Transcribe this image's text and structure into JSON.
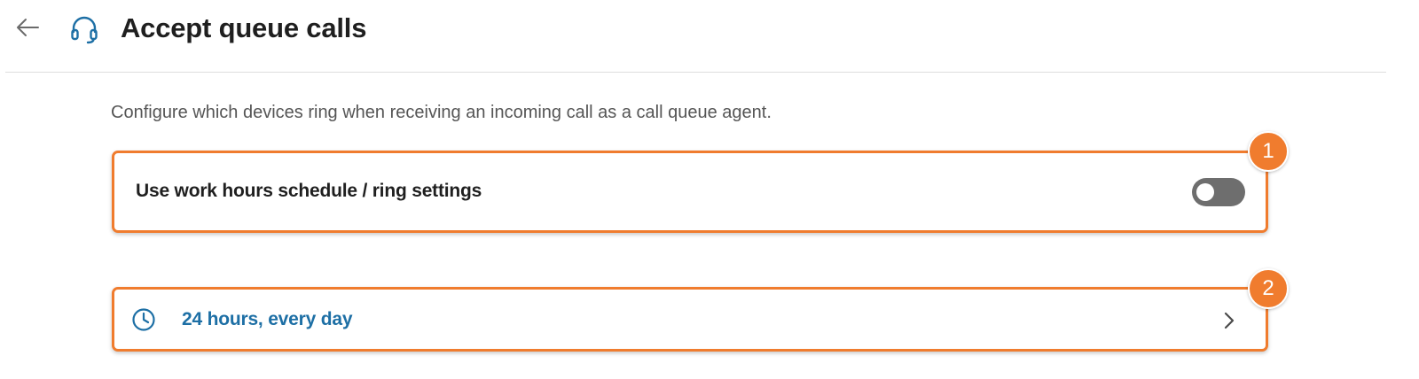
{
  "header": {
    "title": "Accept queue calls",
    "back_icon": "arrow-left-icon",
    "title_icon": "headset-icon"
  },
  "description": "Configure which devices ring when receiving an incoming call as a call queue agent.",
  "work_hours_setting": {
    "label": "Use work hours schedule / ring settings",
    "toggle_on": false
  },
  "schedule": {
    "label": "24 hours, every day",
    "icon": "clock-icon",
    "chevron_icon": "chevron-right-icon"
  },
  "annotations": [
    {
      "number": "1"
    },
    {
      "number": "2"
    }
  ],
  "colors": {
    "accent_orange": "#f07c2e",
    "link_blue": "#1d6fa5",
    "toggle_off_gray": "#6e6e6e",
    "title_text": "#1f1f1f",
    "description_text": "#555555"
  }
}
